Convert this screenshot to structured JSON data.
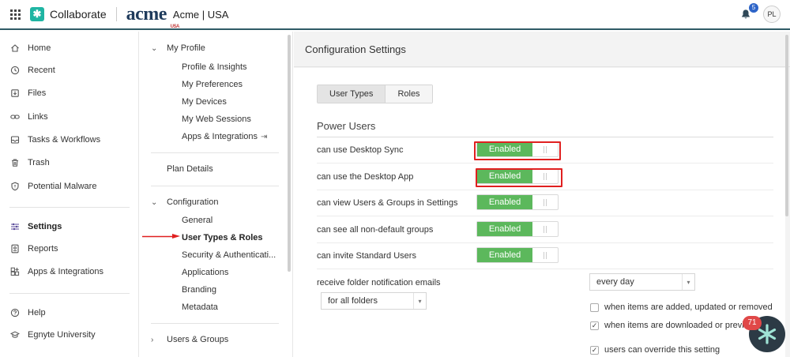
{
  "app": {
    "name": "Collaborate",
    "logo_word": "acme",
    "logo_sub": "USA",
    "tenant": "Acme | USA"
  },
  "header": {
    "notification_count": "5",
    "user_initials": "PL"
  },
  "leftnav": {
    "items": [
      {
        "label": "Home",
        "icon": "home-icon"
      },
      {
        "label": "Recent",
        "icon": "clock-icon"
      },
      {
        "label": "Files",
        "icon": "files-icon"
      },
      {
        "label": "Links",
        "icon": "link-icon"
      },
      {
        "label": "Tasks & Workflows",
        "icon": "tasks-icon"
      },
      {
        "label": "Trash",
        "icon": "trash-icon"
      },
      {
        "label": "Potential Malware",
        "icon": "shield-icon"
      },
      {
        "label": "Settings",
        "icon": "sliders-icon"
      },
      {
        "label": "Reports",
        "icon": "reports-icon"
      },
      {
        "label": "Apps & Integrations",
        "icon": "apps-icon"
      },
      {
        "label": "Help",
        "icon": "help-icon"
      },
      {
        "label": "Egnyte University",
        "icon": "graduation-icon"
      }
    ]
  },
  "settings_nav": {
    "my_profile": {
      "label": "My Profile",
      "items": [
        "Profile & Insights",
        "My Preferences",
        "My Devices",
        "My Web Sessions",
        "Apps & Integrations"
      ]
    },
    "plan_details": "Plan Details",
    "configuration": {
      "label": "Configuration",
      "items": [
        "General",
        "User Types & Roles",
        "Security & Authenticati...",
        "Applications",
        "Branding",
        "Metadata"
      ]
    },
    "users_groups": "Users & Groups"
  },
  "main": {
    "title": "Configuration Settings",
    "tabs": [
      "User Types",
      "Roles"
    ],
    "section_title": "Power Users",
    "toggle_rows": [
      {
        "label": "can use Desktop Sync",
        "state": "Enabled"
      },
      {
        "label": "can use the Desktop App",
        "state": "Enabled"
      },
      {
        "label": "can view Users & Groups in Settings",
        "state": "Enabled"
      },
      {
        "label": "can see all non-default groups",
        "state": "Enabled"
      },
      {
        "label": "can invite Standard Users",
        "state": "Enabled"
      }
    ],
    "folder_notifications": {
      "label": "receive folder notification emails",
      "frequency": "every day",
      "scope": "for all folders",
      "options": [
        {
          "label": "when items are added, updated or removed",
          "checked": false
        },
        {
          "label": "when items are downloaded or previ",
          "checked": true
        },
        {
          "label": "users can override this setting",
          "checked": true
        }
      ]
    }
  },
  "help_widget": {
    "badge": "71"
  }
}
